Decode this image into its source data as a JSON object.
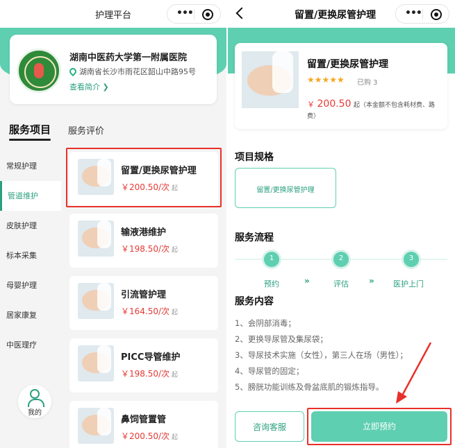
{
  "left": {
    "nav_title": "护理平台",
    "hospital": {
      "name": "湖南中医药大学第一附属医院",
      "address": "湖南省长沙市雨花区韶山中路95号",
      "intro_link": "查看简介 ❯"
    },
    "tabs": {
      "services": "服务项目",
      "reviews": "服务评价"
    },
    "categories": [
      "常规护理",
      "管道维护",
      "皮肤护理",
      "标本采集",
      "母婴护理",
      "居家康复",
      "中医理疗"
    ],
    "me_label": "我的",
    "services": [
      {
        "name": "留置/更换尿管护理",
        "price": "￥200.50/次",
        "suffix": "起"
      },
      {
        "name": "输液港维护",
        "price": "￥198.50/次",
        "suffix": "起"
      },
      {
        "name": "引流管护理",
        "price": "￥164.50/次",
        "suffix": "起"
      },
      {
        "name": "PICC导管维护",
        "price": "￥198.50/次",
        "suffix": "起"
      },
      {
        "name": "鼻饲管置管",
        "price": "￥200.50/次",
        "suffix": "起"
      }
    ]
  },
  "right": {
    "nav_title": "留置/更换尿管护理",
    "product": {
      "name": "留置/更换尿管护理",
      "stars": "★★★★★",
      "sold": "已购 3",
      "currency": "￥",
      "price": "200.50",
      "price_suffix": "起（本金额不包含耗材费、路",
      "price_note_2": "费）"
    },
    "spec_title": "项目规格",
    "spec_option": "留置/更换尿管护理",
    "flow_title": "服务流程",
    "flow_steps": [
      "1",
      "2",
      "3"
    ],
    "flow_labels": [
      "预约",
      "评估",
      "医护上门"
    ],
    "flow_arrow": "»",
    "content_title": "服务内容",
    "content_lines": [
      "1、会阴部消毒；",
      "2、更换导尿管及集尿袋；",
      "3、导尿技术实施（女性），第三人在场（男性）；",
      "4、导尿管的固定；",
      "5、膀胱功能训练及骨盆底肌的锻炼指导。"
    ],
    "consult_button": "咨询客服",
    "book_button": "立即预约"
  },
  "colors": {
    "accent": "#5ecfb1",
    "accent_dark": "#2ba07f",
    "price": "#e53935",
    "highlight": "#e8302a"
  }
}
